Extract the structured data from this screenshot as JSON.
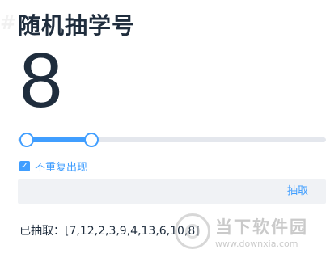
{
  "header": {
    "hash": "#",
    "title": "随机抽学号"
  },
  "display": {
    "number": "8"
  },
  "range_slider": {
    "min_level": 0.03,
    "max_level": 0.24
  },
  "options": {
    "no_repeat_label": "不重复出现",
    "no_repeat_checked": true,
    "check_icon": "check-icon"
  },
  "actions": {
    "draw_label": "抽取"
  },
  "result": {
    "text": "已抽取：[7,12,2,3,9,4,13,6,10,8]"
  },
  "watermark": {
    "name": "当下软件园",
    "url": "www.downxia.com"
  },
  "colors": {
    "accent": "#409eff",
    "text": "#1f2d3d",
    "rail": "#e4e7ed",
    "bar_bg": "#f0f2f5"
  }
}
